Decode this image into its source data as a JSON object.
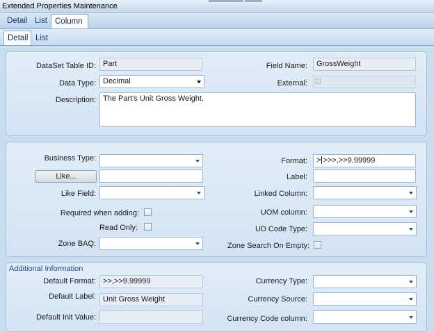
{
  "window": {
    "title": "Extended Properties Maintenance"
  },
  "top_tabs": [
    "Detail",
    "List",
    "Column"
  ],
  "sub_tabs": [
    "Detail",
    "List"
  ],
  "section1": {
    "dataset_label": "DataSet Table ID:",
    "dataset_value": "Part",
    "fieldname_label": "Field Name:",
    "fieldname_value": "GrossWeight",
    "datatype_label": "Data Type:",
    "datatype_value": "Decimal",
    "external_label": "External:",
    "description_label": "Description:",
    "description_value": "The Part's Unit Gross Weight."
  },
  "section2": {
    "business_type_label": "Business Type:",
    "like_button": "Like...",
    "like_field_label": "Like Field:",
    "required_label": "Required when adding:",
    "readonly_label": "Read Only:",
    "zone_baq_label": "Zone BAQ:",
    "format_label": "Format:",
    "format_value_a": ">",
    "format_value_b": ">>>,>>9.99999",
    "label_label": "Label:",
    "linked_column_label": "Linked Column:",
    "uom_column_label": "UOM column:",
    "ud_code_type_label": "UD Code Type:",
    "zone_search_label": "Zone Search On Empty:"
  },
  "section3": {
    "title": "Additional Information",
    "default_format_label": "Default Format:",
    "default_format_value": ">>,>>9.99999",
    "default_label_label": "Default Label:",
    "default_label_value": "Unit Gross Weight",
    "default_init_label": "Default Init Value:",
    "currency_type_label": "Currency Type:",
    "currency_source_label": "Currency Source:",
    "currency_code_label": "Currency Code column:"
  }
}
